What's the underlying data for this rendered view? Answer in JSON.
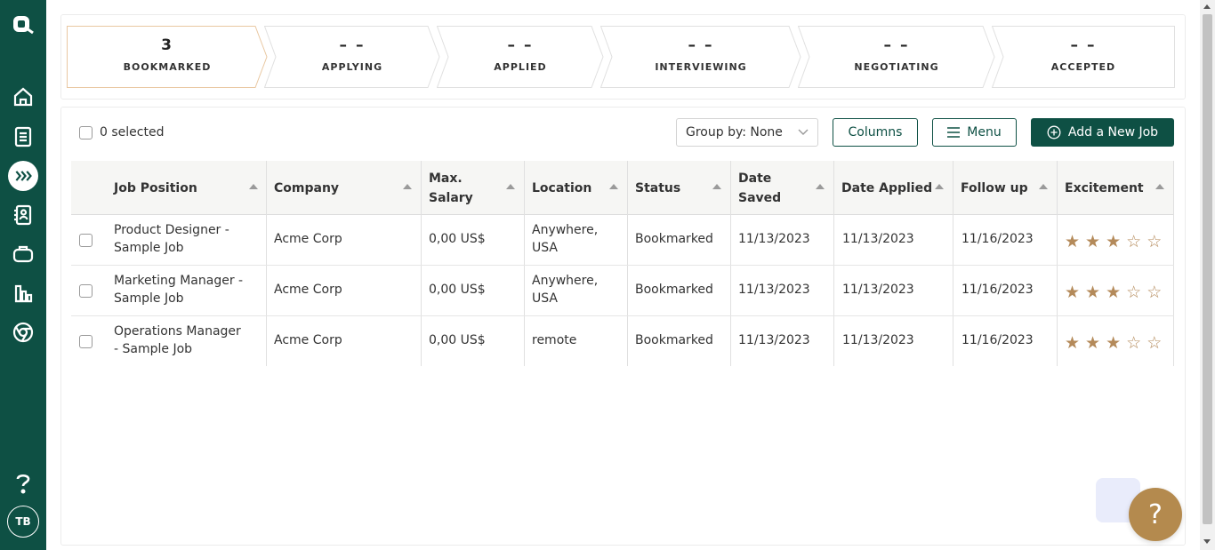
{
  "user": {
    "initials": "TB"
  },
  "stages": [
    {
      "count": "3",
      "label": "BOOKMARKED",
      "active": true
    },
    {
      "count": "– –",
      "label": "APPLYING"
    },
    {
      "count": "– –",
      "label": "APPLIED"
    },
    {
      "count": "– –",
      "label": "INTERVIEWING"
    },
    {
      "count": "– –",
      "label": "NEGOTIATING"
    },
    {
      "count": "– –",
      "label": "ACCEPTED"
    }
  ],
  "toolbar": {
    "selected": "0 selected",
    "group_by": "Group by: None",
    "columns": "Columns",
    "menu": "Menu",
    "add_job": "Add a New Job"
  },
  "table": {
    "headers": {
      "position": "Job Position",
      "company": "Company",
      "salary_1": "Max.",
      "salary_2": "Salary",
      "location": "Location",
      "status": "Status",
      "saved_1": "Date",
      "saved_2": "Saved",
      "applied": "Date Applied",
      "follow": "Follow up",
      "excitement": "Excitement"
    },
    "rows": [
      {
        "pos1": "Product Designer -",
        "pos2": "Sample Job",
        "company": "Acme Corp",
        "salary": "0,00 US$",
        "loc1": "Anywhere,",
        "loc2": "USA",
        "status": "Bookmarked",
        "saved": "11/13/2023",
        "applied": "11/13/2023",
        "follow": "11/16/2023",
        "excitement": 3
      },
      {
        "pos1": "Marketing Manager -",
        "pos2": "Sample Job",
        "company": "Acme Corp",
        "salary": "0,00 US$",
        "loc1": "Anywhere,",
        "loc2": "USA",
        "status": "Bookmarked",
        "saved": "11/13/2023",
        "applied": "11/13/2023",
        "follow": "11/16/2023",
        "excitement": 3
      },
      {
        "pos1": "Operations Manager",
        "pos2": "- Sample Job",
        "company": "Acme Corp",
        "salary": "0,00 US$",
        "loc1": "remote",
        "loc2": "",
        "status": "Bookmarked",
        "saved": "11/13/2023",
        "applied": "11/13/2023",
        "follow": "11/16/2023",
        "excitement": 3
      }
    ]
  },
  "help": {
    "label": "?"
  },
  "colors": {
    "sidebar": "#0e5044",
    "accent": "#b48a4e",
    "star": "#b48a5a"
  }
}
